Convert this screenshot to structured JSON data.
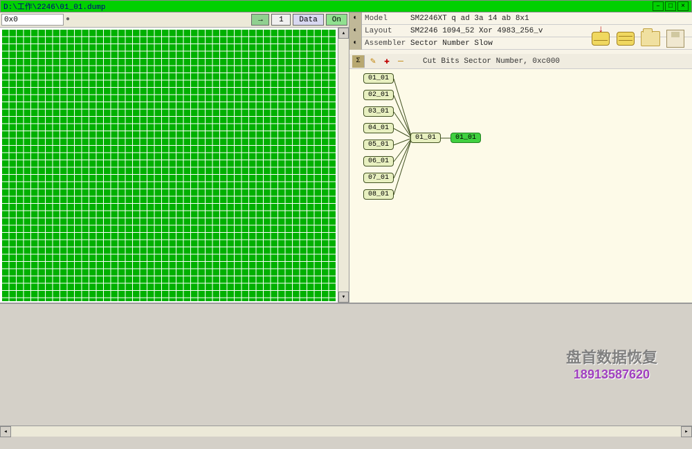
{
  "window": {
    "title": "D:\\工作\\2246\\01_01.dump",
    "close": "×",
    "max": "□",
    "min": "–"
  },
  "left_toolbar": {
    "address": "0x0",
    "pin": "●",
    "arrow": "→",
    "page": "1",
    "data_btn": "Data",
    "on_btn": "On"
  },
  "info": {
    "model_label": "Model",
    "model_value": "SM2246XT  q  ad 3a 14 ab  8x1",
    "layout_label": "Layout",
    "layout_value": "SM2246 1094_52 Xor 4983_256_v",
    "assembler_label": "Assembler",
    "assembler_value": "Sector Number Slow"
  },
  "action_bar": {
    "wand": "✎",
    "plus": "✚",
    "minus": "—",
    "text": "Cut Bits Sector Number, 0xc000"
  },
  "tree": {
    "leaves": [
      "01_01",
      "02_01",
      "03_01",
      "04_01",
      "05_01",
      "06_01",
      "07_01",
      "08_01"
    ],
    "mid": "01_01",
    "end": "01_01"
  },
  "icons": {
    "disk_dl": "disk-download",
    "disk": "disk",
    "folder": "folder",
    "save": "save"
  },
  "watermark": {
    "text": "盘首数据恢复",
    "phone": "18913587620"
  },
  "scroll": {
    "up": "▴",
    "down": "▾",
    "left": "◂",
    "right": "▸"
  }
}
